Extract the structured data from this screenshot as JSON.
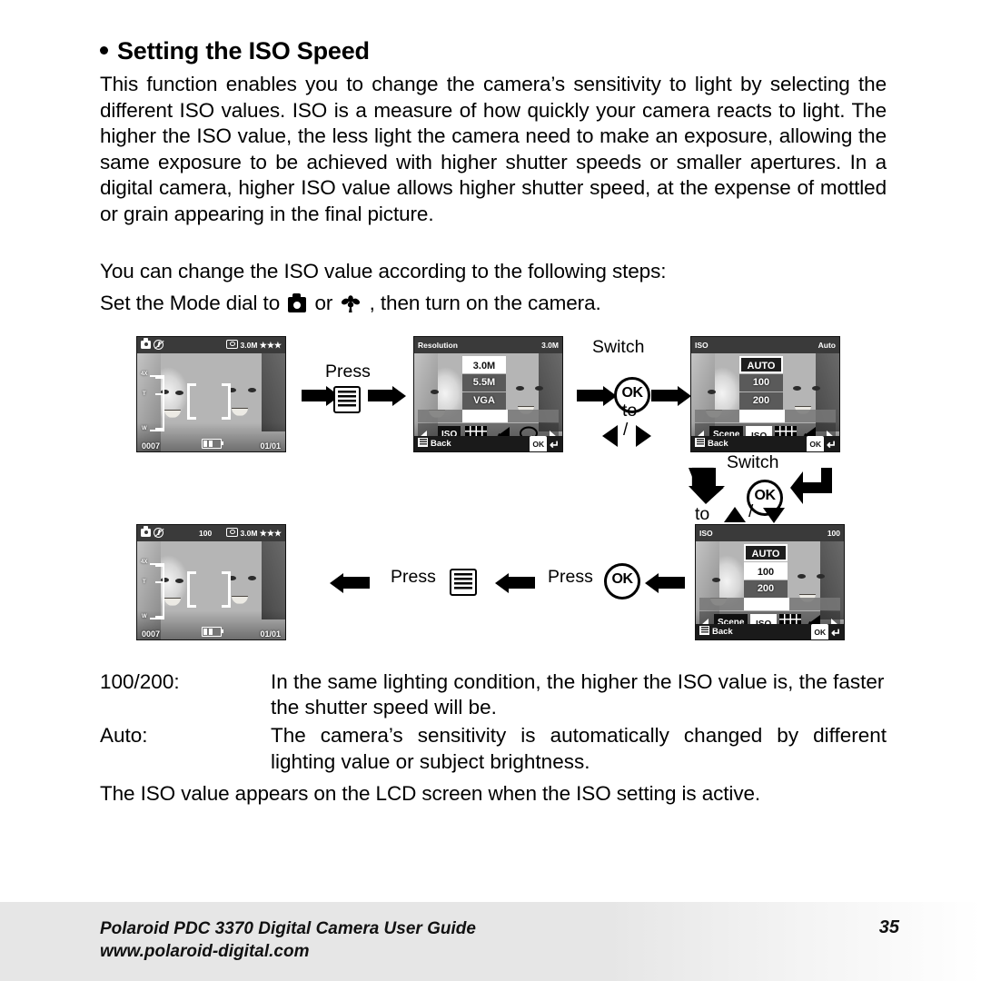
{
  "section": {
    "title": "Setting the ISO Speed",
    "paragraph1": "This function enables you to change the camera’s sensitivity to light by selecting the different ISO values. ISO is a measure of how quickly your camera reacts to light. The higher the ISO value, the less light the camera need to make an exposure, allowing the same exposure to be achieved with higher shutter speeds or smaller apertures. In a digital camera, higher ISO value allows higher shutter speed, at the expense of mottled or grain appearing in the final picture.",
    "paragraph2_line1": "You can change the ISO value according to the following steps:",
    "paragraph2_pre": "Set the Mode dial to",
    "paragraph2_mid": "or",
    "paragraph2_post": ", then turn on the camera.",
    "closing": "The ISO value appears on the LCD screen when the ISO setting is active."
  },
  "flow": {
    "labels": {
      "press": "Press",
      "switch": "Switch",
      "to": "to",
      "slash": "/",
      "ok": "OK"
    }
  },
  "screens": {
    "live1": {
      "quality_label": "3.0M",
      "stars": "★★★",
      "counter": "0007",
      "frames": "01/01",
      "zoom_top": "4X",
      "zoom_tele": "T",
      "zoom_wide": "W"
    },
    "resolution_menu": {
      "title": "Resolution",
      "value": "3.0M",
      "options": [
        "3.0M",
        "5.5M",
        "VGA"
      ],
      "selected": "3.0M",
      "icons": [
        "ISO",
        "grid-icon",
        "flash-icon",
        "pencil-icon"
      ],
      "back_label": "Back",
      "ok_label": "OK"
    },
    "iso_menu_auto": {
      "title": "ISO",
      "value": "Auto",
      "options": [
        "AUTO",
        "100",
        "200"
      ],
      "selected": "AUTO",
      "icons": [
        "Scene",
        "ISO",
        "grid-icon",
        "flash-icon"
      ],
      "back_label": "Back",
      "ok_label": "OK"
    },
    "iso_menu_100": {
      "title": "ISO",
      "value": "100",
      "options": [
        "AUTO",
        "100",
        "200"
      ],
      "selected": "100",
      "icons": [
        "Scene",
        "ISO",
        "grid-icon",
        "flash-icon"
      ],
      "back_label": "Back",
      "ok_label": "OK"
    },
    "live2": {
      "iso_value": "100",
      "quality_label": "3.0M",
      "stars": "★★★",
      "counter": "0007",
      "frames": "01/01",
      "zoom_top": "4X",
      "zoom_tele": "T",
      "zoom_wide": "W"
    }
  },
  "definitions": [
    {
      "term": "100/200:",
      "desc": "In the same lighting condition, the higher the ISO value is, the faster the shutter speed will be."
    },
    {
      "term": "Auto:",
      "desc": "The camera’s sensitivity is automatically changed by different lighting value or subject brightness."
    }
  ],
  "footer": {
    "line1": "Polaroid PDC 3370 Digital Camera User Guide",
    "line2": "www.polaroid-digital.com",
    "page_number": "35"
  }
}
